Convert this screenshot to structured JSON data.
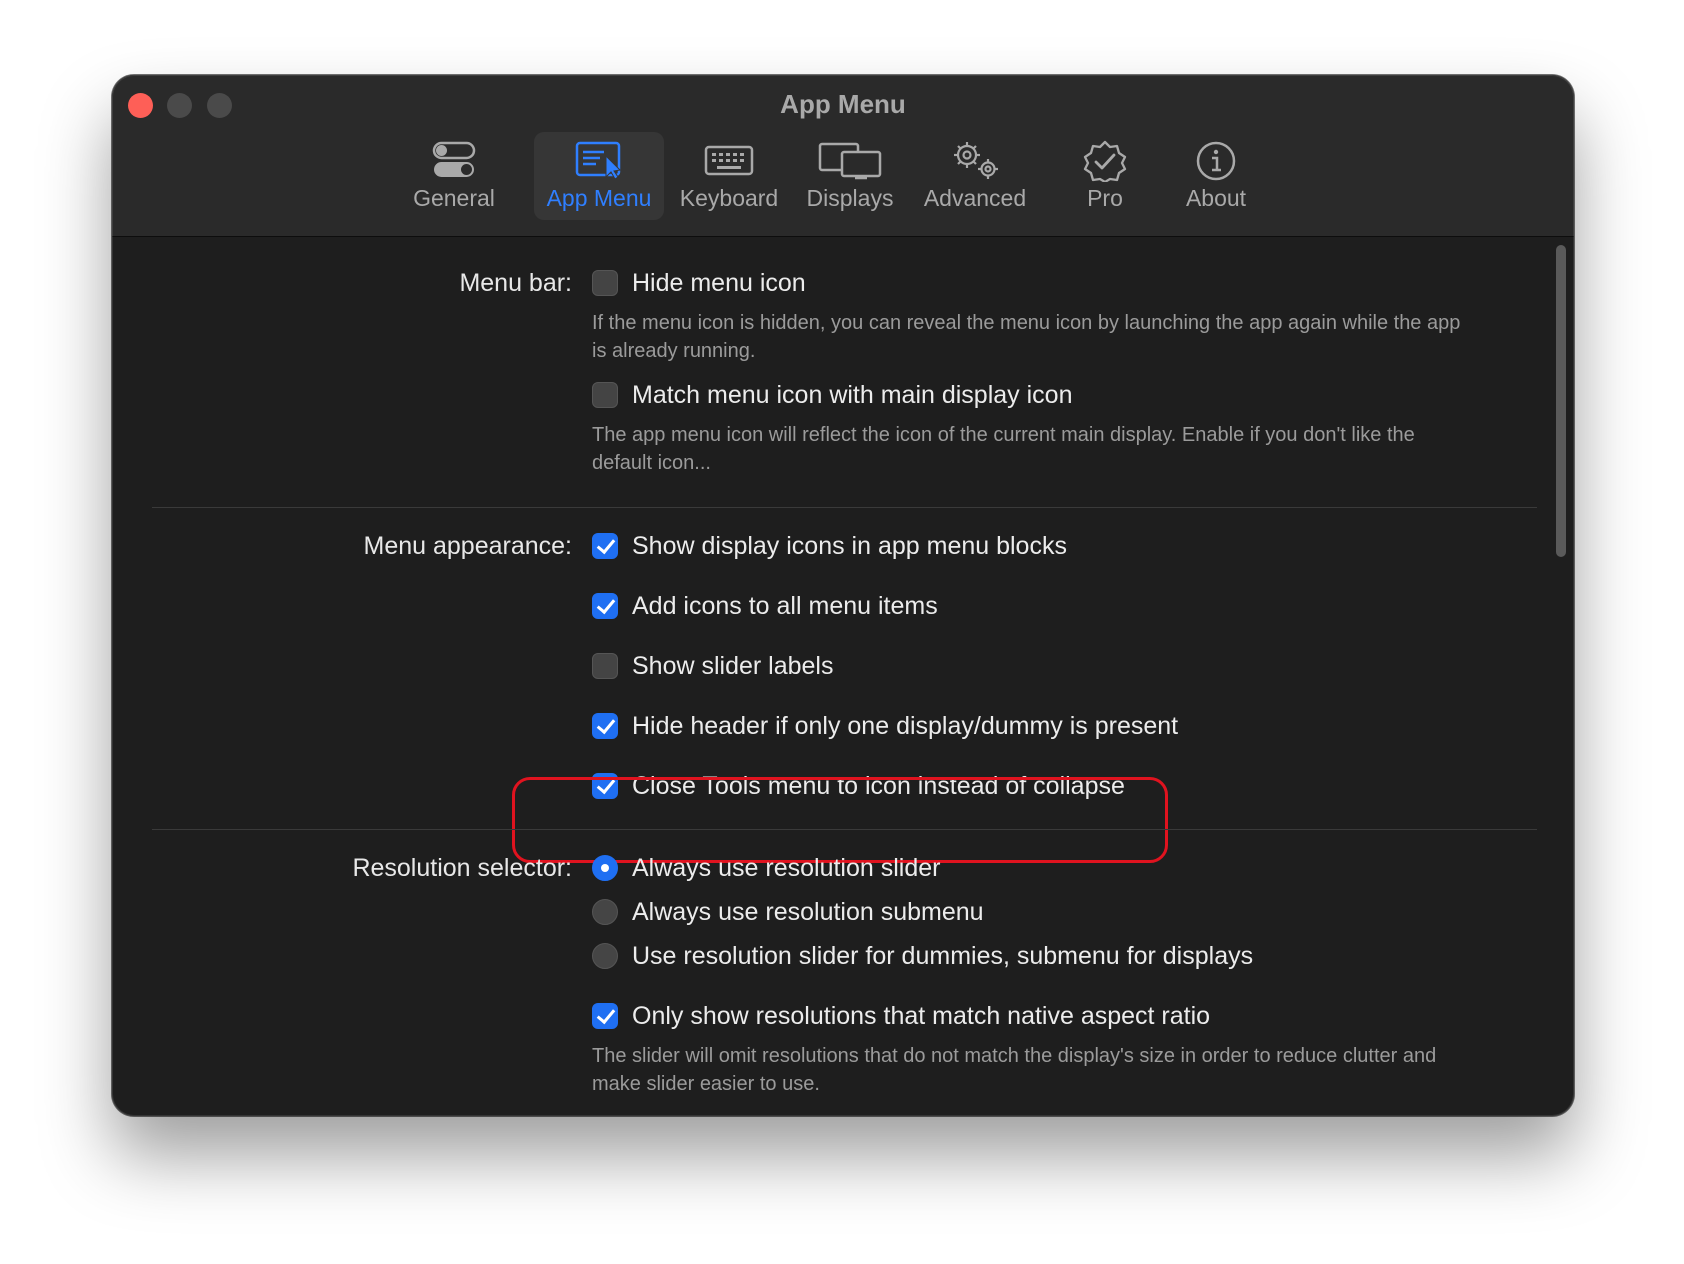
{
  "window": {
    "title": "App Menu"
  },
  "tabs": [
    {
      "label": "General",
      "icon": "toggle-switches-icon"
    },
    {
      "label": "App Menu",
      "icon": "app-menu-icon",
      "selected": true
    },
    {
      "label": "Keyboard",
      "icon": "keyboard-icon"
    },
    {
      "label": "Displays",
      "icon": "displays-icon"
    },
    {
      "label": "Advanced",
      "icon": "gears-icon"
    },
    {
      "label": "Pro",
      "icon": "verified-badge-icon"
    },
    {
      "label": "About",
      "icon": "info-icon"
    }
  ],
  "menu_bar": {
    "label": "Menu bar:",
    "hide_menu_icon": {
      "label": "Hide menu icon",
      "checked": false
    },
    "hide_menu_icon_desc": "If the menu icon is hidden, you can reveal the menu icon by launching the app again while the app is already running.",
    "match_icon": {
      "label": "Match menu icon with main display icon",
      "checked": false
    },
    "match_icon_desc": "The app menu icon will reflect the icon of the current main display. Enable if you don't like the default icon..."
  },
  "menu_appearance": {
    "label": "Menu appearance:",
    "options": [
      {
        "label": "Show display icons in app menu blocks",
        "checked": true
      },
      {
        "label": "Add icons to all menu items",
        "checked": true
      },
      {
        "label": "Show slider labels",
        "checked": false
      },
      {
        "label": "Hide header if only one display/dummy is present",
        "checked": true
      },
      {
        "label": "Close Tools menu to icon instead of collapse",
        "checked": true
      }
    ]
  },
  "resolution_selector": {
    "label": "Resolution selector:",
    "radios": [
      {
        "label": "Always use resolution slider",
        "selected": true
      },
      {
        "label": "Always use resolution submenu",
        "selected": false
      },
      {
        "label": "Use resolution slider for dummies, submenu for displays",
        "selected": false
      }
    ],
    "native_aspect": {
      "label": "Only show resolutions that match native aspect ratio",
      "checked": true
    },
    "native_aspect_desc": "The slider will omit resolutions that do not match the display's size in order to reduce clutter and make slider easier to use."
  },
  "colors": {
    "accent": "#1f6ff2",
    "highlight": "#e0131f",
    "close": "#fe5f57"
  }
}
